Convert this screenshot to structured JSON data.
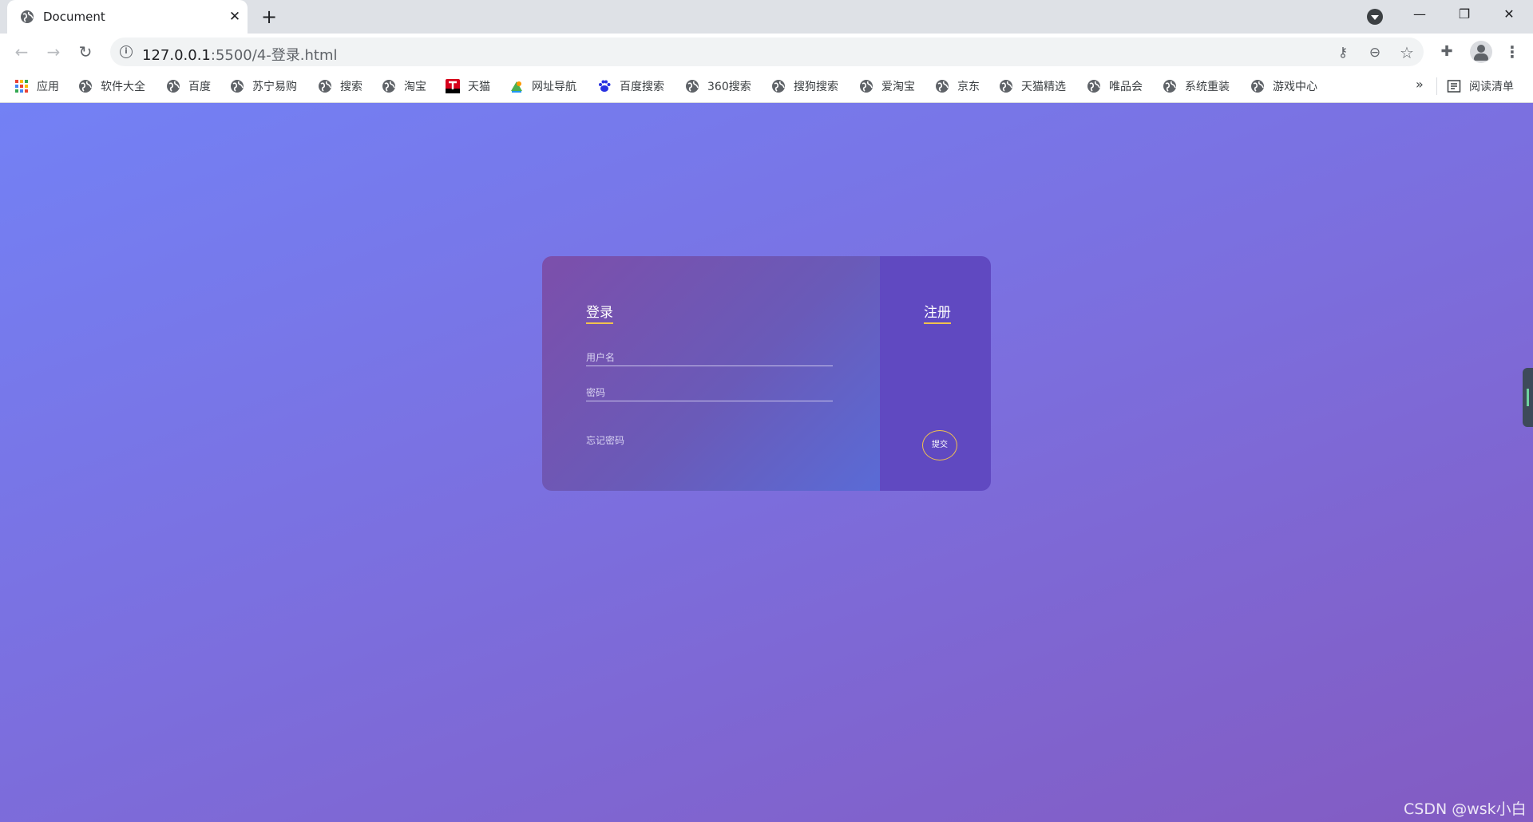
{
  "tab": {
    "title": "Document",
    "close_symbol": "✕",
    "new_tab_symbol": "+"
  },
  "window": {
    "minimize": "—",
    "maximize": "❐",
    "close": "✕"
  },
  "toolbar": {
    "back": "←",
    "forward": "→",
    "reload": "↻",
    "info": "i",
    "url_host": "127.0.0.1",
    "url_path": ":5500/4-登录.html",
    "key": "⚷",
    "zoom": "⊖",
    "star": "☆",
    "extensions": "✚",
    "menu": "⋮"
  },
  "bookmarks": {
    "items": [
      {
        "label": "应用",
        "icon": "apps-grid-icon"
      },
      {
        "label": "软件大全",
        "icon": "globe-icon"
      },
      {
        "label": "百度",
        "icon": "globe-icon"
      },
      {
        "label": "苏宁易购",
        "icon": "globe-icon"
      },
      {
        "label": "搜索",
        "icon": "globe-icon"
      },
      {
        "label": "淘宝",
        "icon": "globe-icon"
      },
      {
        "label": "天猫",
        "icon": "tmall-icon"
      },
      {
        "label": "网址导航",
        "icon": "nav-site-icon"
      },
      {
        "label": "百度搜索",
        "icon": "baidu-paw-icon"
      },
      {
        "label": "360搜索",
        "icon": "globe-icon"
      },
      {
        "label": "搜狗搜索",
        "icon": "globe-icon"
      },
      {
        "label": "爱淘宝",
        "icon": "globe-icon"
      },
      {
        "label": "京东",
        "icon": "globe-icon"
      },
      {
        "label": "天猫精选",
        "icon": "globe-icon"
      },
      {
        "label": "唯品会",
        "icon": "globe-icon"
      },
      {
        "label": "系统重装",
        "icon": "globe-icon"
      },
      {
        "label": "游戏中心",
        "icon": "globe-icon"
      }
    ],
    "more": "»",
    "reading_list": "阅读清单"
  },
  "login": {
    "title": "登录",
    "username_placeholder": "用户名",
    "password_placeholder": "密码",
    "forgot": "忘记密码"
  },
  "register": {
    "title": "注册",
    "submit": "提交"
  },
  "watermark": "CSDN @wsk小白",
  "colors": {
    "accent_underline": "#f2c24d",
    "card_right": "#6049c1",
    "bg_start": "#7381f5",
    "bg_end": "#835bc2"
  }
}
